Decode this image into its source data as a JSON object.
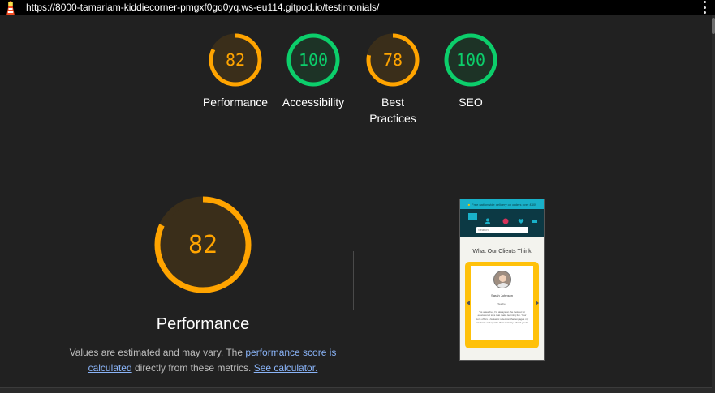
{
  "browser": {
    "url": "https://8000-tamariam-kiddiecorner-pmgxf0gq0yq.ws-eu114.gitpod.io/testimonials/"
  },
  "colors": {
    "average": "#ffa400",
    "pass": "#0cce6b",
    "average_bg": "#3a2e1a",
    "pass_bg": "#1d3326",
    "track": "#333333"
  },
  "scores": [
    {
      "label": "Performance",
      "value": 82,
      "rating": "average"
    },
    {
      "label": "Accessibility",
      "value": 100,
      "rating": "pass"
    },
    {
      "label": "Best Practices",
      "value": 78,
      "rating": "average"
    },
    {
      "label": "SEO",
      "value": 100,
      "rating": "pass"
    }
  ],
  "performance": {
    "score": 82,
    "title": "Performance",
    "desc_prefix": "Values are estimated and may vary. The ",
    "link_score": "performance score is calculated",
    "desc_middle": " directly from these metrics. ",
    "link_calculator": "See calculator."
  },
  "screenshot": {
    "banner": "Free nationwide delivery on orders over £40!",
    "search_placeholder": "Search",
    "heading": "What Our Clients Think",
    "name": "Sarah Johnson",
    "role": "Teacher",
    "quote": "\"As a teacher, I'm always on the lookout for educational toys that make learning fun. Your store offers a fantastic selection that engages my students and sparks their curiosity. Thank you!\""
  }
}
